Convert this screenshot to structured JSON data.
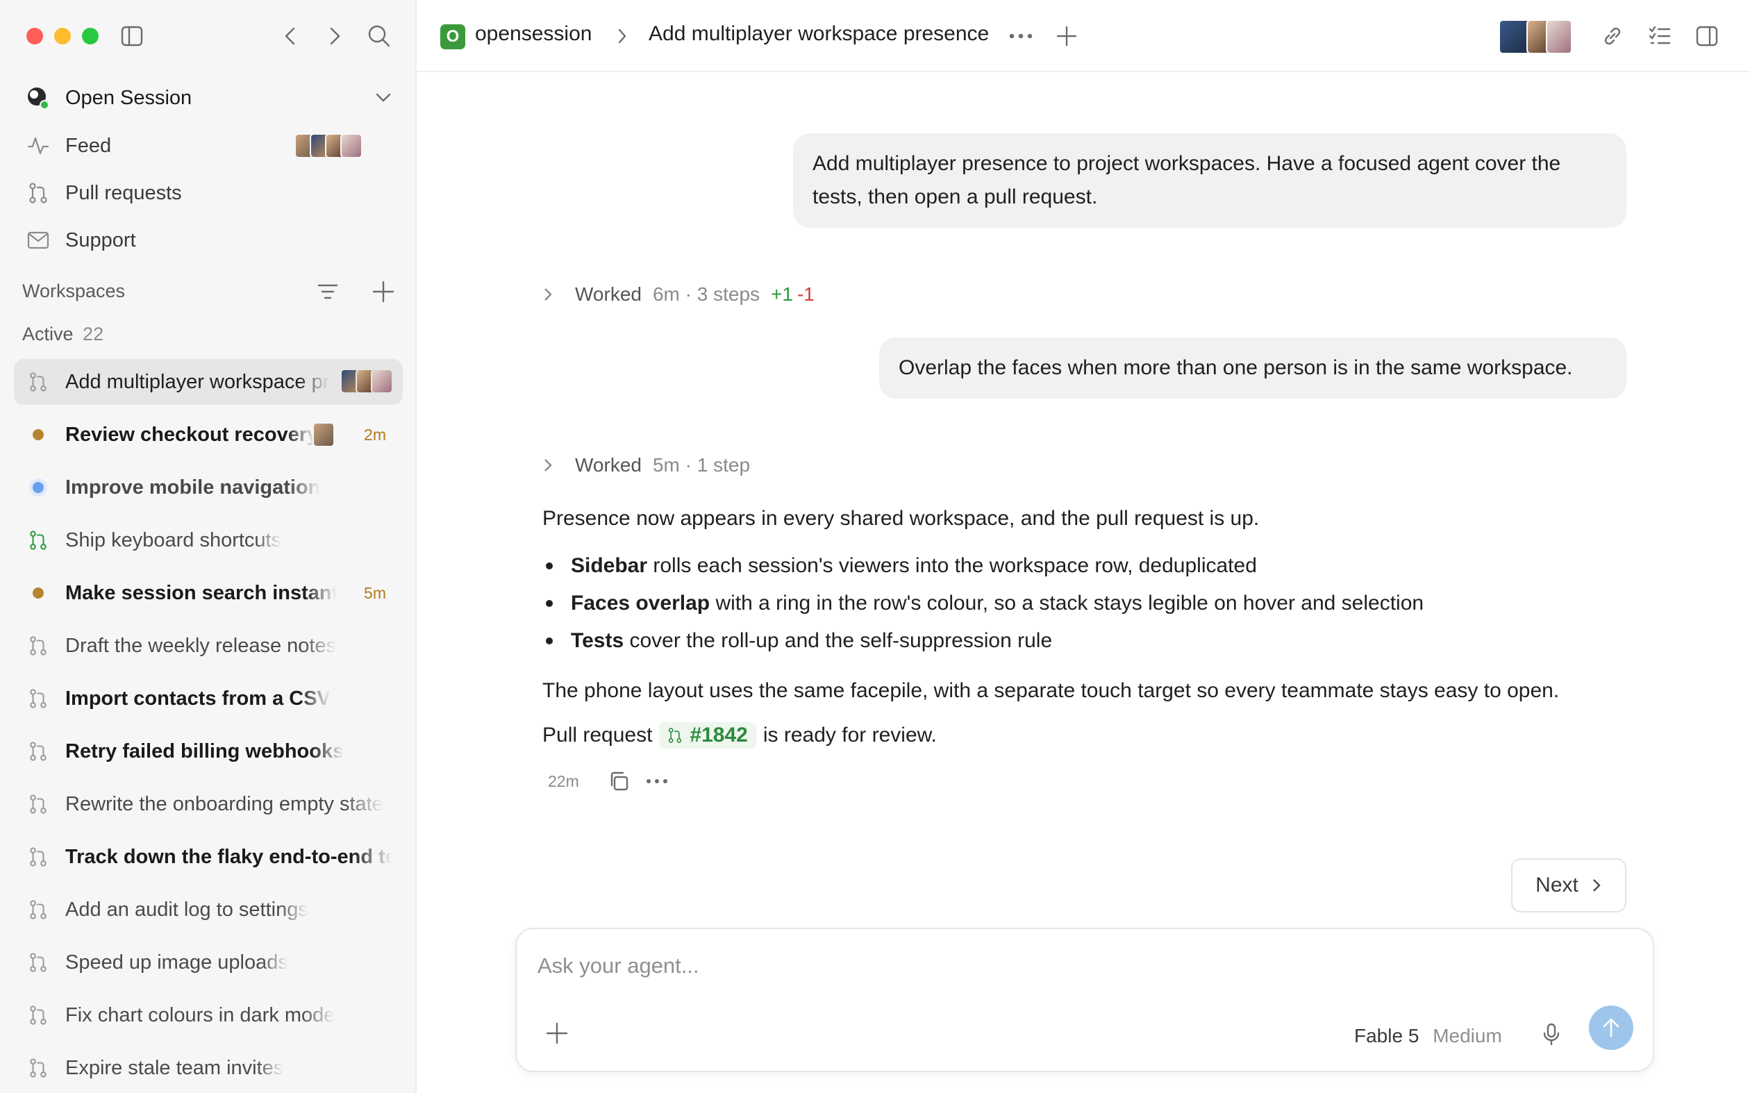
{
  "sidebar": {
    "account": {
      "name": "Open Session"
    },
    "nav": [
      {
        "label": "Feed"
      },
      {
        "label": "Pull requests"
      },
      {
        "label": "Support"
      }
    ],
    "workspaces_heading": "Workspaces",
    "active_label": "Active",
    "active_count": "22",
    "workspaces": [
      {
        "label": "Add multiplayer workspace presence",
        "status": "pr",
        "bold": false,
        "time": ""
      },
      {
        "label": "Review checkout recovery",
        "status": "dot-amber",
        "bold": true,
        "time": "2m"
      },
      {
        "label": "Improve mobile navigation",
        "status": "dot-blue",
        "bold": true,
        "time": ""
      },
      {
        "label": "Ship keyboard shortcuts",
        "status": "pr-green",
        "bold": false,
        "time": ""
      },
      {
        "label": "Make session search instant",
        "status": "dot-amber",
        "bold": true,
        "time": "5m"
      },
      {
        "label": "Draft the weekly release notes",
        "status": "pr",
        "bold": false,
        "time": ""
      },
      {
        "label": "Import contacts from a CSV",
        "status": "pr",
        "bold": true,
        "time": ""
      },
      {
        "label": "Retry failed billing webhooks",
        "status": "pr",
        "bold": true,
        "time": ""
      },
      {
        "label": "Rewrite the onboarding empty state",
        "status": "pr",
        "bold": false,
        "time": ""
      },
      {
        "label": "Track down the flaky end-to-end test",
        "status": "pr",
        "bold": true,
        "time": ""
      },
      {
        "label": "Add an audit log to settings",
        "status": "pr",
        "bold": false,
        "time": ""
      },
      {
        "label": "Speed up image uploads",
        "status": "pr",
        "bold": false,
        "time": ""
      },
      {
        "label": "Fix chart colours in dark mode",
        "status": "pr",
        "bold": false,
        "time": ""
      },
      {
        "label": "Expire stale team invites",
        "status": "pr",
        "bold": false,
        "time": ""
      }
    ]
  },
  "header": {
    "project_initial": "O",
    "project": "opensession",
    "title": "Add multiplayer workspace presence"
  },
  "conversation": {
    "user_message_1": [
      "Add multiplayer presence to project workspaces. Have a focused agent cover the",
      "tests, then open a pull request."
    ],
    "worked_1": {
      "label": "Worked",
      "meta": "6m · 3 steps",
      "plus": "+1",
      "minus": "-1"
    },
    "user_message_2": "Overlap the faces when more than one person is in the same workspace.",
    "worked_2": {
      "label": "Worked",
      "meta": "5m · 1 step"
    },
    "reply_intro": "Presence now appears in every shared workspace, and the pull request is up.",
    "bullets": [
      {
        "bold": "Sidebar",
        "rest": " rolls each session's viewers into the workspace row, deduplicated"
      },
      {
        "bold": "Faces overlap",
        "rest": " with a ring in the row's colour, so a stack stays legible on hover and selection"
      },
      {
        "bold": "Tests",
        "rest": " cover the roll-up and the self-suppression rule"
      }
    ],
    "reply_outro": "The phone layout uses the same facepile, with a separate touch target so every teammate stays easy to open.",
    "pr_prefix": "Pull request",
    "pr_number": "#1842",
    "pr_suffix": "is ready for review.",
    "reply_time": "22m"
  },
  "next_label": "Next",
  "composer": {
    "placeholder": "Ask your agent...",
    "model": "Fable 5",
    "effort": "Medium"
  },
  "colors": {
    "accent_green": "#2b8a3e",
    "diff_minus": "#d23b3b",
    "status_amber": "#b07a1a",
    "status_blue": "#6a9ef0",
    "send_button": "#9dc6ea"
  }
}
